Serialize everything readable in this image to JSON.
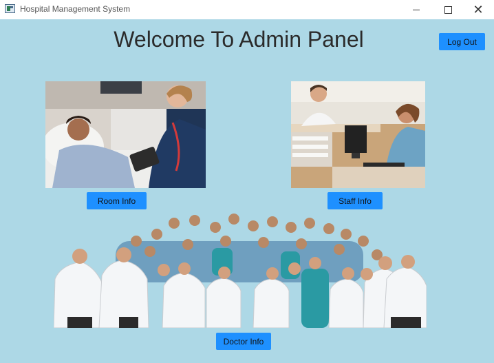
{
  "window": {
    "title": "Hospital Management System",
    "icon": "app-window-icon",
    "controls": [
      "minimize-icon",
      "maximize-icon",
      "close-icon"
    ]
  },
  "main": {
    "title": "Welcome To Admin Panel",
    "logout_label": "Log Out",
    "room_label": "Room Info",
    "staff_label": "Staff Info",
    "doctor_label": "Doctor Info"
  },
  "colors": {
    "background": "#add8e6",
    "button": "#1e90ff"
  }
}
